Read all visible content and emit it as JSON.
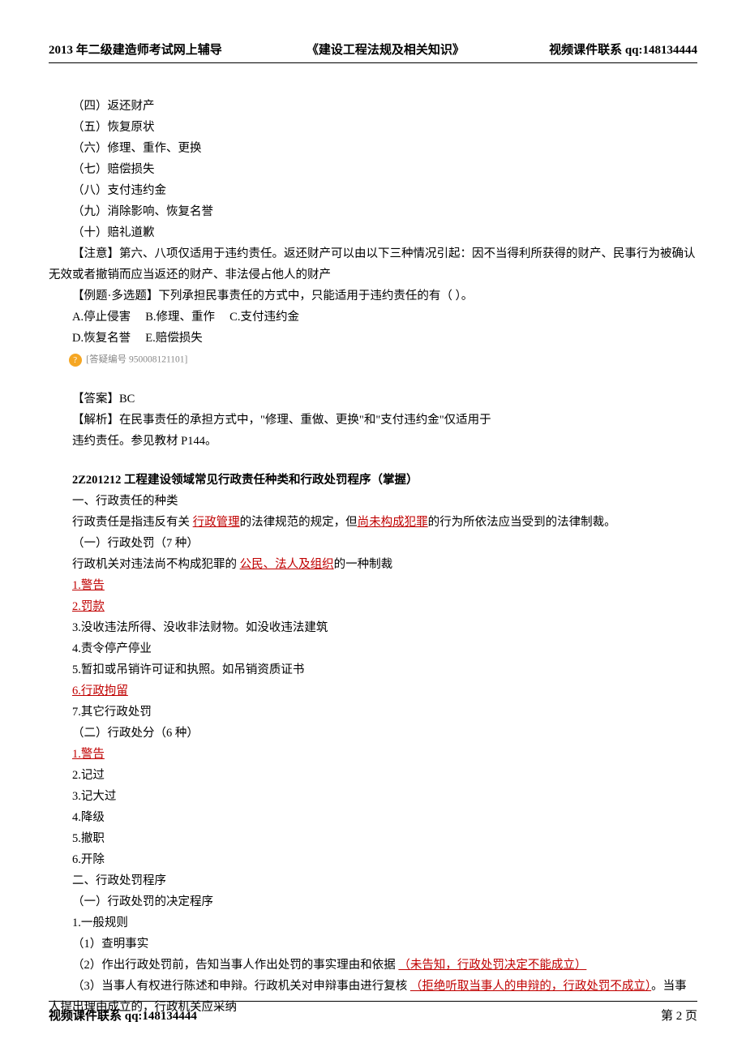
{
  "header": {
    "left": "2013 年二级建造师考试网上辅导",
    "center": "《建设工程法规及相关知识》",
    "right": "视频课件联系 qq:148134444"
  },
  "lines": {
    "l4": "（四）返还财产",
    "l5": "（五）恢复原状",
    "l6": "（六）修理、重作、更换",
    "l7": "（七）赔偿损失",
    "l8": "（八）支付违约金",
    "l9": "（九）消除影响、恢复名誉",
    "l10": "（十）赔礼道歉",
    "note": "【注意】第六、八项仅适用于违约责任。返还财产可以由以下三种情况引起：因不当得利所获得的财产、民事行为被确认无效或者撤销而应当返还的财产、非法侵占他人的财产",
    "ex": "【例题·多选题】下列承担民事责任的方式中，只能适用于违约责任的有（  ）。",
    "optA": "A.停止侵害",
    "optB": "B.修理、重作",
    "optC": "C.支付违约金",
    "optD": "D.恢复名誉",
    "optE": "E.赔偿损失",
    "noteIcon": "?",
    "noteNum": "[答疑编号 950008121101]",
    "ans": "【答案】BC",
    "analysis": "【解析】在民事责任的承担方式中，\"修理、重做、更换\"和\"支付违约金\"仅适用于",
    "analysis2": "违约责任。参见教材 P144。",
    "sectTitle": "2Z201212  工程建设领域常见行政责任种类和行政处罚程序（掌握）",
    "s1": "一、行政责任的种类",
    "s2a": "行政责任是指违反有关 ",
    "s2b": "行政管理",
    "s2c": "的法律规范的规定，但",
    "s2d": "尚未构成犯罪",
    "s2e": "的行为所依法应当受到的法律制裁。",
    "s3": "（一）行政处罚（7 种）",
    "s4a": "行政机关对违法尚不构成犯罪的 ",
    "s4b": "公民、法人及组织",
    "s4c": "的一种制裁",
    "p1": "1.警告",
    "p2": "2.罚款",
    "p3": "3.没收违法所得、没收非法财物。如没收违法建筑",
    "p4": "4.责令停产停业",
    "p5": "5.暂扣或吊销许可证和执照。如吊销资质证书",
    "p6": "6.行政拘留",
    "p7": "7.其它行政处罚",
    "s5": "（二）行政处分（6 种）",
    "d1": "1.警告",
    "d2": "2.记过",
    "d3": "3.记大过",
    "d4": "4.降级",
    "d5": "5.撤职",
    "d6": "6.开除",
    "s6": "二、行政处罚程序",
    "s7": "（一）行政处罚的决定程序",
    "s8": "1.一般规则",
    "s9": "（1）查明事实",
    "s10a": "（2）作出行政处罚前，告知当事人作出处罚的事实理由和依据 ",
    "s10b": "（未告知，行政处罚决定不能成立）",
    "s11a": "（3）当事人有权进行陈述和申辩。行政机关对申辩事由进行复核 ",
    "s11b": "（拒绝听取当事人的申辩的，行政处罚不成立）",
    "s11c": "。当事人提出理由成立的，行政机关应采纳"
  },
  "footer": {
    "left": "视频课件联系 qq:148134444",
    "page": "第 2 页"
  }
}
